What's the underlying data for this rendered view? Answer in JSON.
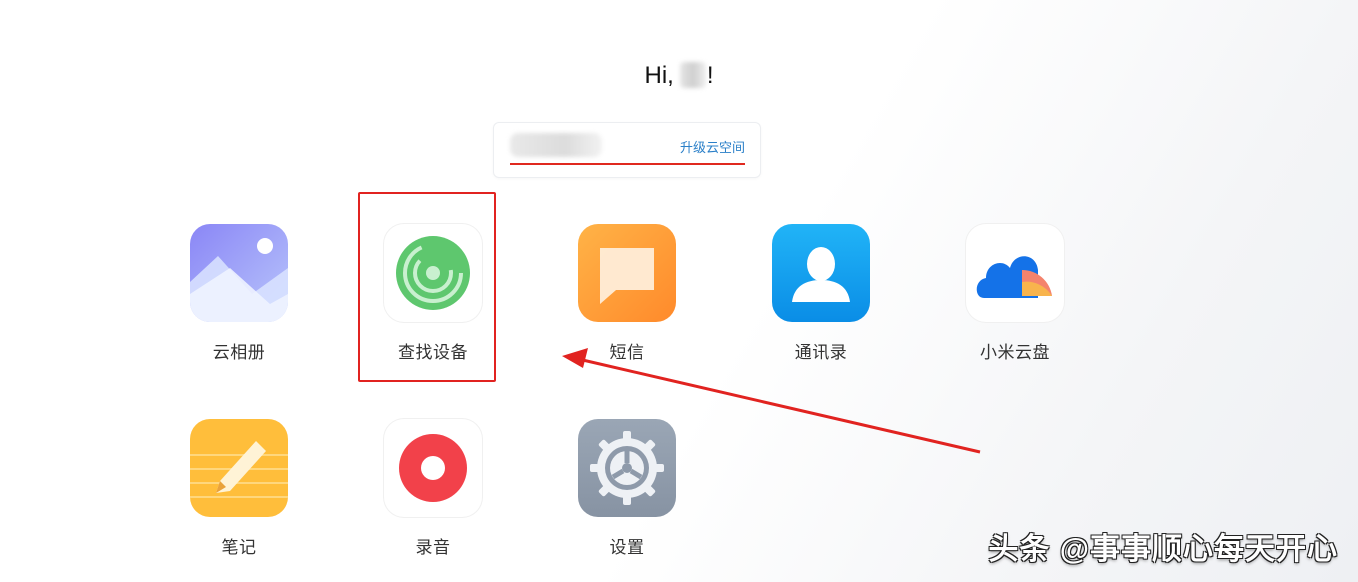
{
  "greeting": {
    "prefix": "Hi,",
    "suffix": "!"
  },
  "storage": {
    "upgrade_label": "升级云空间"
  },
  "apps": [
    {
      "label": "云相册",
      "icon": "gallery-icon"
    },
    {
      "label": "查找设备",
      "icon": "find-device-icon"
    },
    {
      "label": "短信",
      "icon": "message-icon"
    },
    {
      "label": "通讯录",
      "icon": "contacts-icon"
    },
    {
      "label": "小米云盘",
      "icon": "cloud-drive-icon"
    },
    {
      "label": "笔记",
      "icon": "notes-icon"
    },
    {
      "label": "录音",
      "icon": "recorder-icon"
    },
    {
      "label": "设置",
      "icon": "settings-icon"
    }
  ],
  "watermark": "头条 @事事顺心每天开心",
  "colors": {
    "accent_red": "#e12320",
    "link_blue": "#2a7fc8"
  }
}
